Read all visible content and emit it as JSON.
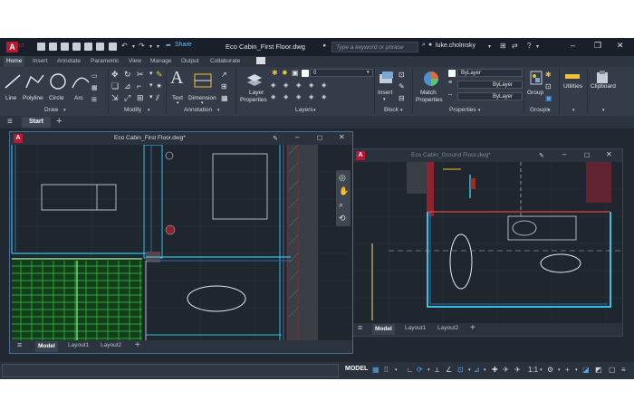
{
  "app": {
    "logo": "A",
    "logo_sub": "LT",
    "title": "Eco Cabin_First Floor.dwg",
    "share_label": "Share",
    "search_placeholder": "Type a keyword or phrase",
    "user": "luke.cholmsky"
  },
  "ribbon_tabs": [
    "Home",
    "Insert",
    "Annotate",
    "Parametric",
    "View",
    "Manage",
    "Output",
    "Collaborate"
  ],
  "ribbon": {
    "draw_tools": [
      "Line",
      "Polyline",
      "Circle",
      "Arc"
    ],
    "draw_title": "Draw",
    "modify_title": "Modify",
    "annotation_tools": [
      "Text",
      "Dimension"
    ],
    "annotation_title": "Annotation",
    "layer_properties_label": [
      "Layer",
      "Properties"
    ],
    "layer_combo_value": "0",
    "layers_title": "Layers",
    "insert_label": "Insert",
    "block_title": "Block",
    "match_properties_label": [
      "Match",
      "Properties"
    ],
    "bylayer_values": [
      "ByLayer",
      "ByLayer",
      "ByLayer"
    ],
    "properties_title": "Properties",
    "group_label": "Group",
    "groups_title": "Groups",
    "utilities_label": "Utilities",
    "clipboard_label": "Clipboard",
    "colors": {
      "accent": "#3d8fd8",
      "brand": "#c0152f"
    }
  },
  "file_tabs": {
    "start_label": "Start",
    "add_label": "+"
  },
  "windows": [
    {
      "title": "Eco Cabin_First Floor.dwg*",
      "layout_tabs": [
        "Model",
        "Layout1",
        "Layout2"
      ],
      "active_layout": "Model"
    },
    {
      "title": "Eco Cabin_Ground Floor.dwg*",
      "layout_tabs": [
        "Model",
        "Layout1",
        "Layout2"
      ],
      "active_layout": "Model"
    }
  ],
  "statusbar": {
    "model_label": "MODEL",
    "scale": "1:1"
  }
}
